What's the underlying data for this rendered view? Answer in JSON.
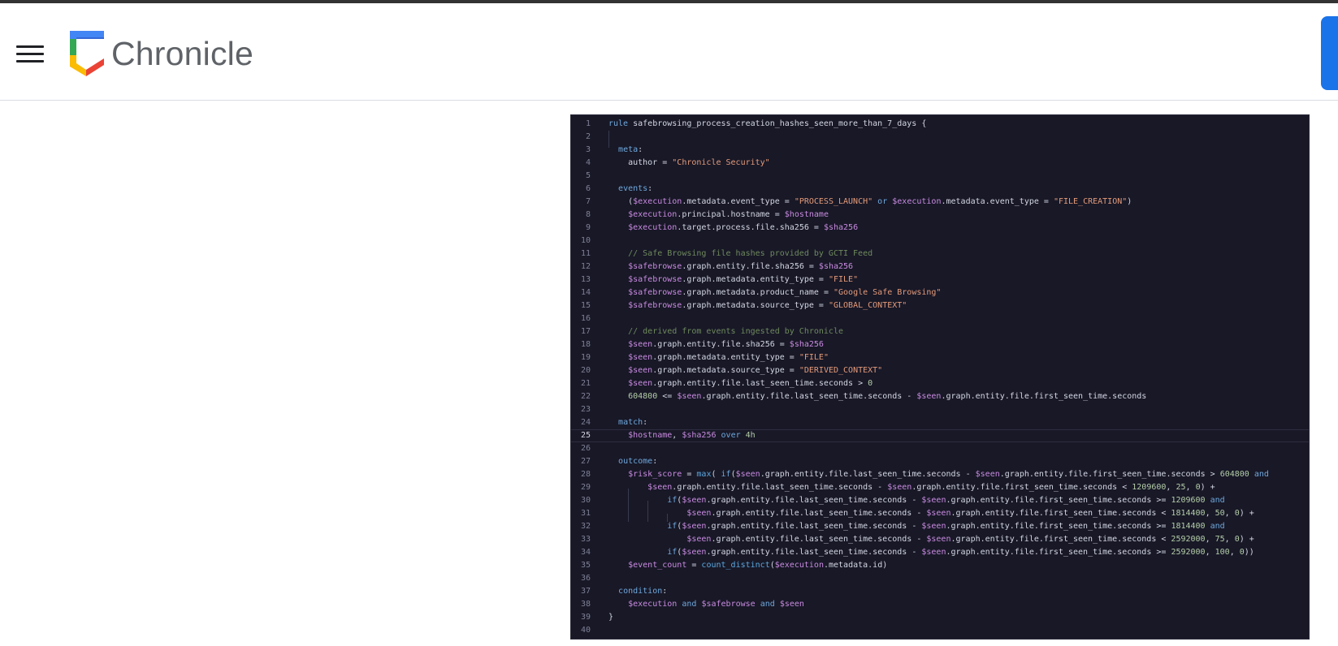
{
  "app": {
    "brand": "Chronicle"
  },
  "colors": {
    "accent": "#1a73e8",
    "code_background": "#181827",
    "keyword": "#6fa8dc",
    "string": "#e49b7a",
    "comment": "#6f8a5c",
    "variable": "#c98be0",
    "number": "#b5cea8",
    "function": "#5ba8e0"
  },
  "icons": {
    "menu": "menu-icon",
    "logo": "chronicle-logo-icon"
  },
  "code": {
    "lines": [
      "rule safebrowsing_process_creation_hashes_seen_more_than_7_days {",
      "",
      "  meta:",
      "    author = \"Chronicle Security\"",
      "",
      "  events:",
      "    ($execution.metadata.event_type = \"PROCESS_LAUNCH\" or $execution.metadata.event_type = \"FILE_CREATION\")",
      "    $execution.principal.hostname = $hostname",
      "    $execution.target.process.file.sha256 = $sha256",
      "",
      "    // Safe Browsing file hashes provided by GCTI Feed",
      "    $safebrowse.graph.entity.file.sha256 = $sha256",
      "    $safebrowse.graph.metadata.entity_type = \"FILE\"",
      "    $safebrowse.graph.metadata.product_name = \"Google Safe Browsing\"",
      "    $safebrowse.graph.metadata.source_type = \"GLOBAL_CONTEXT\"",
      "",
      "    // derived from events ingested by Chronicle",
      "    $seen.graph.entity.file.sha256 = $sha256",
      "    $seen.graph.metadata.entity_type = \"FILE\"",
      "    $seen.graph.metadata.source_type = \"DERIVED_CONTEXT\"",
      "    $seen.graph.entity.file.last_seen_time.seconds > 0",
      "    604800 <= $seen.graph.entity.file.last_seen_time.seconds - $seen.graph.entity.file.first_seen_time.seconds",
      "",
      "  match:",
      "    $hostname, $sha256 over 4h",
      "",
      "  outcome:",
      "    $risk_score = max( if($seen.graph.entity.file.last_seen_time.seconds - $seen.graph.entity.file.first_seen_time.seconds > 604800 and",
      "        $seen.graph.entity.file.last_seen_time.seconds - $seen.graph.entity.file.first_seen_time.seconds < 1209600, 25, 0) +",
      "            if($seen.graph.entity.file.last_seen_time.seconds - $seen.graph.entity.file.first_seen_time.seconds >= 1209600 and",
      "                $seen.graph.entity.file.last_seen_time.seconds - $seen.graph.entity.file.first_seen_time.seconds < 1814400, 50, 0) +",
      "            if($seen.graph.entity.file.last_seen_time.seconds - $seen.graph.entity.file.first_seen_time.seconds >= 1814400 and",
      "                $seen.graph.entity.file.last_seen_time.seconds - $seen.graph.entity.file.first_seen_time.seconds < 2592000, 75, 0) +",
      "            if($seen.graph.entity.file.last_seen_time.seconds - $seen.graph.entity.file.first_seen_time.seconds >= 2592000, 100, 0))",
      "    $event_count = count_distinct($execution.metadata.id)",
      "",
      "  condition:",
      "    $execution and $safebrowse and $seen",
      "}",
      ""
    ],
    "active_line": 25
  }
}
